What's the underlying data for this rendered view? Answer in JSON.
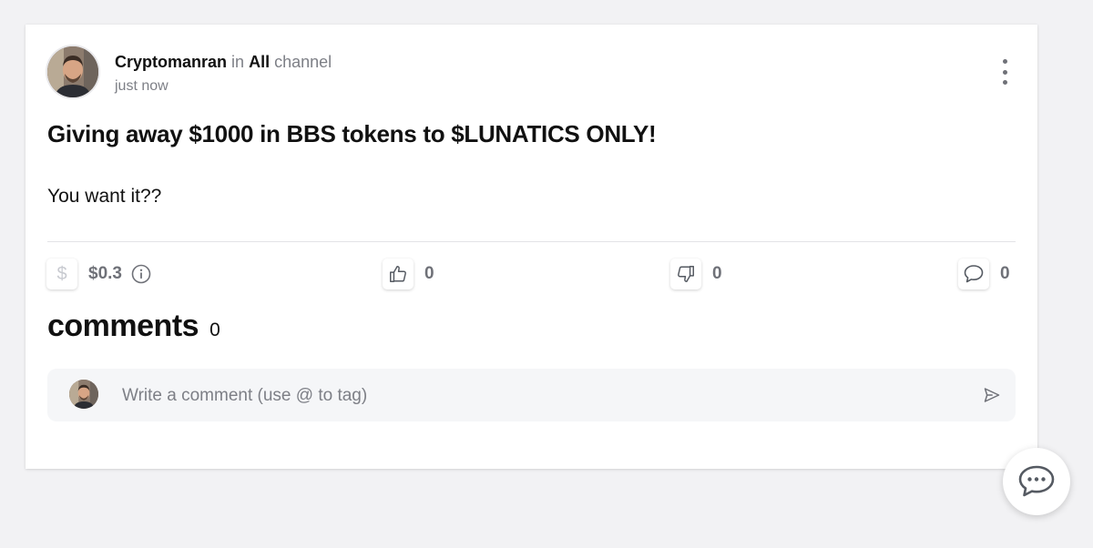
{
  "post": {
    "author": "Cryptomanran",
    "in_label": "in",
    "channel": "All",
    "channel_suffix": "channel",
    "timestamp": "just now",
    "title": "Giving away $1000 in BBS tokens to $LUNATICS ONLY!",
    "body": "You want it??"
  },
  "actions": {
    "tip_icon": "dollar-icon",
    "tip_amount": "$0.3",
    "likes": "0",
    "dislikes": "0",
    "comments": "0"
  },
  "comments": {
    "title": "comments",
    "count": "0",
    "input_placeholder": "Write a comment (use @ to tag)"
  },
  "icons": {
    "menu": "more-vertical-icon",
    "info": "info-icon",
    "like": "thumbs-up-icon",
    "dislike": "thumbs-down-icon",
    "comment": "comment-bubble-icon",
    "send": "send-icon",
    "chat": "chat-icon"
  },
  "colors": {
    "background": "#f2f2f4",
    "card": "#ffffff",
    "muted_text": "#7d7f86",
    "count_text": "#6f7178"
  }
}
